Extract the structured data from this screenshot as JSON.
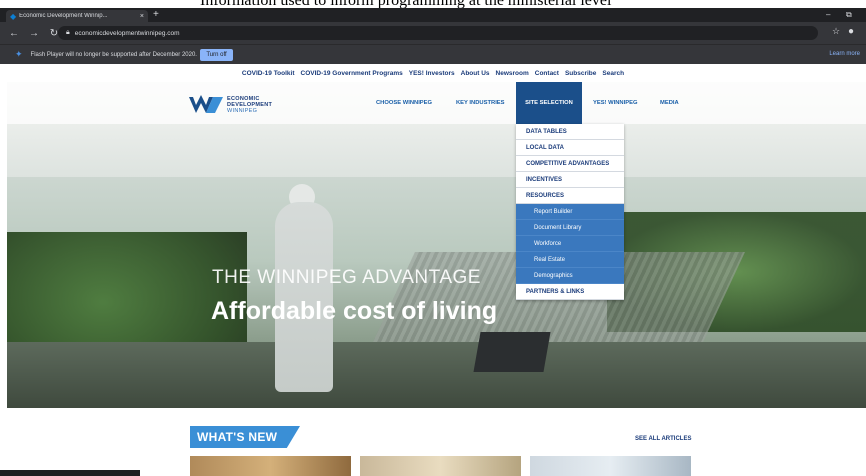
{
  "above_text": "Information used to inform programming at the ministerial level",
  "browser": {
    "tab_title": "Economic Development Winnip...",
    "tab_close": "×",
    "new_tab": "+",
    "minimize": "–",
    "restore": "⧉",
    "url": "economicdevelopmentwinnipeg.com",
    "infobar_message": "Flash Player will no longer be supported after December 2020.",
    "infobar_button": "Turn off",
    "infobar_link": "Learn more"
  },
  "utility_nav": [
    "COVID-19 Toolkit",
    "COVID-19 Government Programs",
    "YES! Investors",
    "About Us",
    "Newsroom",
    "Contact",
    "Subscribe",
    "Search"
  ],
  "logo": {
    "line1": "ECONOMIC",
    "line2": "DEVELOPMENT",
    "line3": "WINNIPEG"
  },
  "main_nav": {
    "choose": "CHOOSE WINNIPEG",
    "industries": "KEY INDUSTRIES",
    "site_selection": "SITE SELECTION",
    "yes_winnipeg": "YES! WINNIPEG",
    "media": "MEDIA"
  },
  "dropdown": {
    "items": [
      "DATA TABLES",
      "LOCAL DATA",
      "COMPETITIVE ADVANTAGES",
      "INCENTIVES",
      "RESOURCES"
    ],
    "sub_items": [
      "Report Builder",
      "Document Library",
      "Workforce",
      "Real Estate",
      "Demographics"
    ],
    "last": "PARTNERS & LINKS"
  },
  "hero": {
    "tagline": "THE WINNIPEG ADVANTAGE",
    "headline": "Affordable cost of living"
  },
  "whats_new": {
    "title": "WHAT'S NEW",
    "see_all": "SEE ALL ARTICLES"
  },
  "colors": {
    "brand_dark": "#1b4f8a",
    "brand_blue": "#3a78be",
    "accent": "#3a8fd6"
  }
}
